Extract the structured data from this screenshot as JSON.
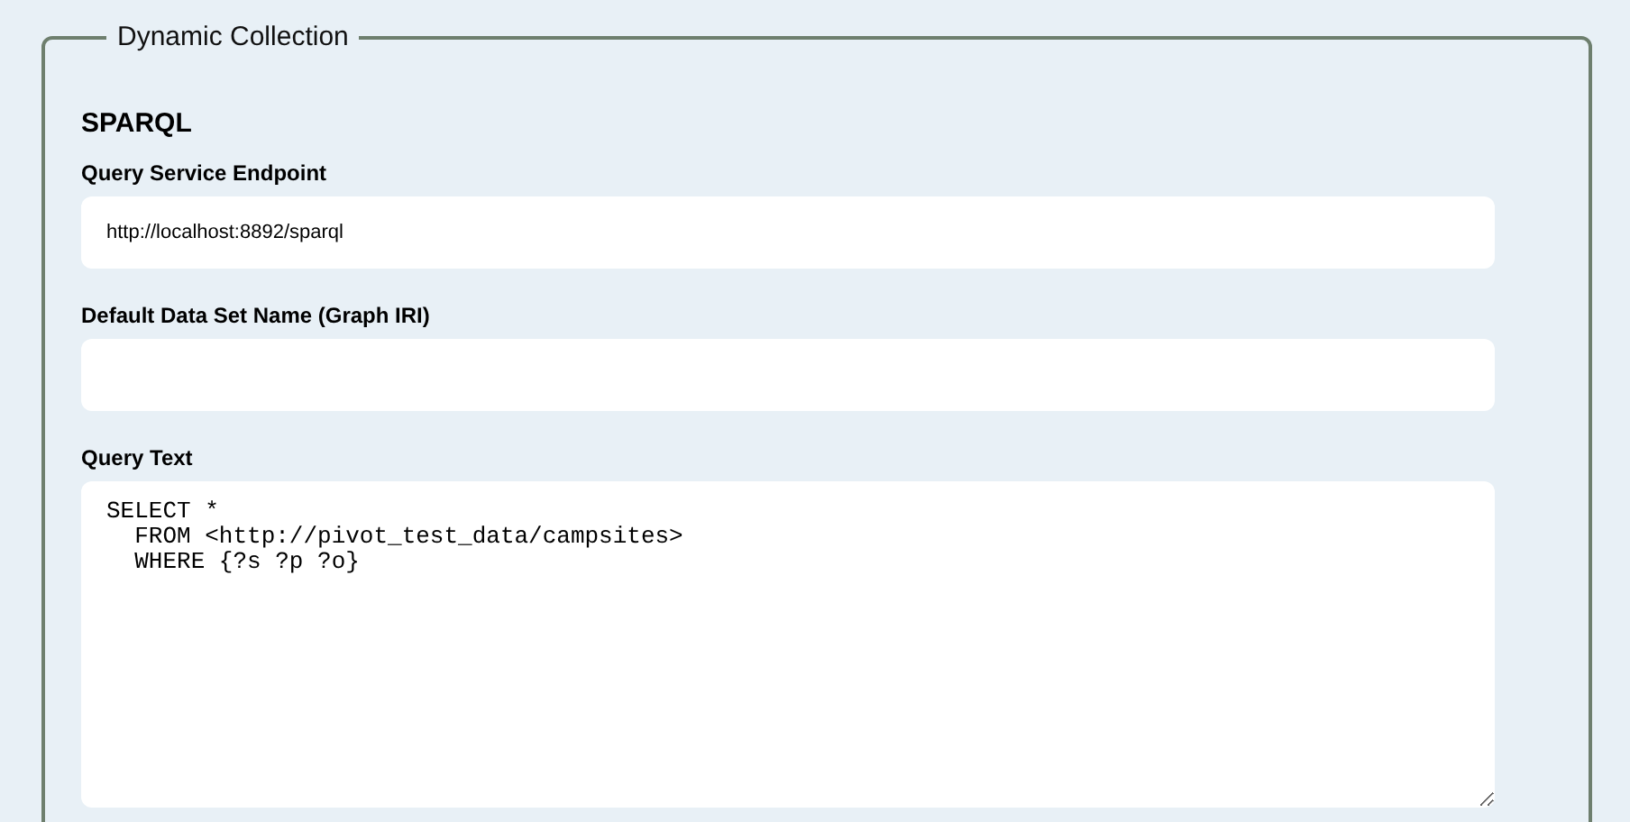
{
  "panel": {
    "legend": "Dynamic Collection",
    "heading": "SPARQL",
    "fields": [
      {
        "kind": "input",
        "label": "Query Service Endpoint",
        "value": "http://localhost:8892/sparql"
      },
      {
        "kind": "input",
        "label": "Default Data Set Name (Graph IRI)"
      },
      {
        "kind": "textarea",
        "label": "Query Text",
        "value": "SELECT *\n  FROM <http://pivot_test_data/campsites>\n  WHERE {?s ?p ?o}"
      }
    ]
  }
}
